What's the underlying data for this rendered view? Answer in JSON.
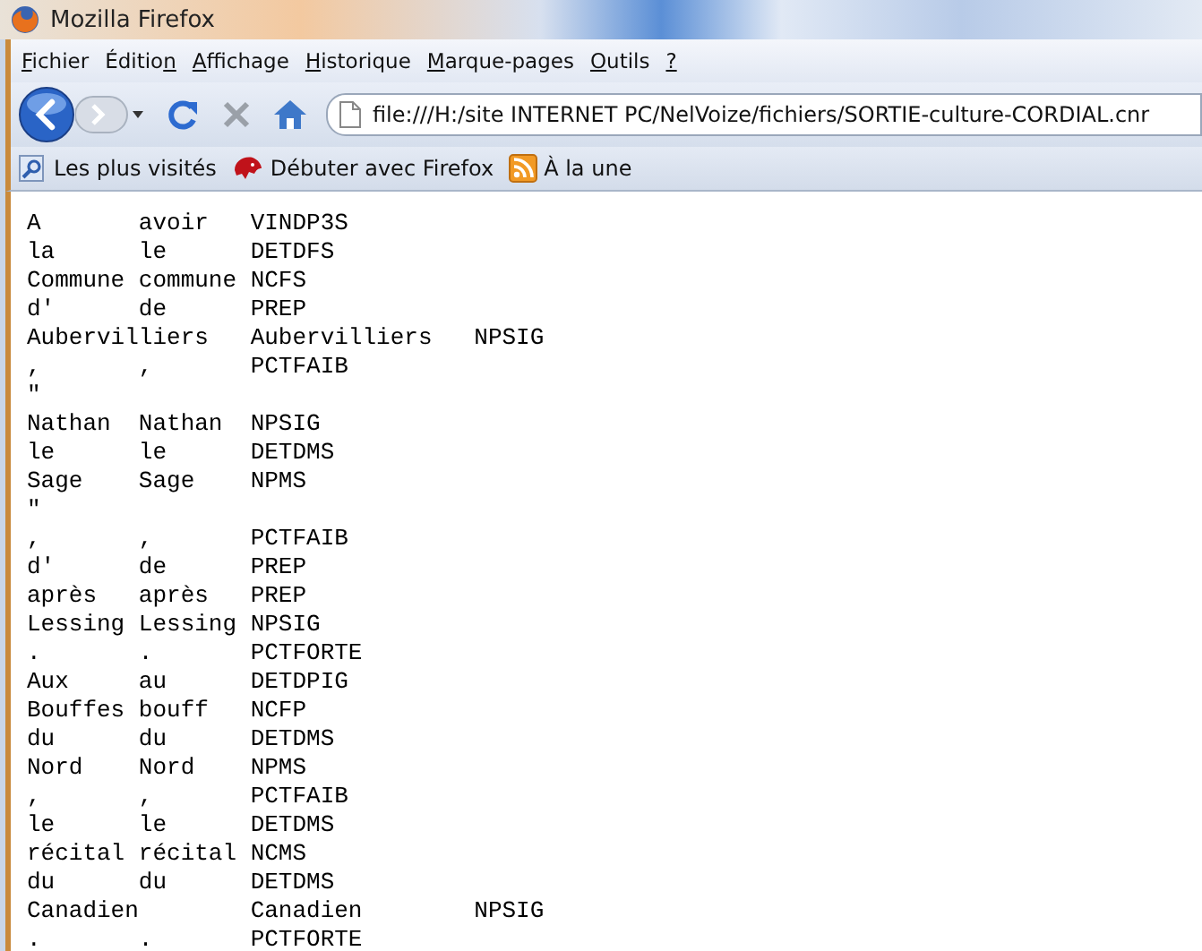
{
  "window": {
    "title": "Mozilla Firefox"
  },
  "menu": [
    {
      "key": "F",
      "after": "ichier"
    },
    {
      "before": "Éditio",
      "key": "n"
    },
    {
      "key": "A",
      "after": "ffichage"
    },
    {
      "key": "H",
      "after": "istorique"
    },
    {
      "key": "M",
      "after": "arque-pages"
    },
    {
      "key": "O",
      "after": "utils"
    },
    {
      "key": "?"
    }
  ],
  "address": {
    "value": "file:///H:/site INTERNET PC/NelVoize/fichiers/SORTIE-culture-CORDIAL.cnr"
  },
  "bookmarks": [
    {
      "label": "Les plus visités",
      "kind": "smart"
    },
    {
      "label": "Débuter avec Firefox",
      "kind": "firefox"
    },
    {
      "label": "À la une",
      "kind": "feed"
    }
  ],
  "content": {
    "lines": [
      "A\tavoir\tVINDP3S",
      "la\tle\tDETDFS",
      "Commune\tcommune\tNCFS",
      "d'\tde\tPREP",
      "Aubervilliers\tAubervilliers\tNPSIG",
      ",\t,\tPCTFAIB",
      "\"",
      "Nathan\tNathan\tNPSIG",
      "le\tle\tDETDMS",
      "Sage\tSage\tNPMS",
      "\"",
      ",\t,\tPCTFAIB",
      "d'\tde\tPREP",
      "après\taprès\tPREP",
      "Lessing\tLessing\tNPSIG",
      ".\t.\tPCTFORTE",
      "Aux\tau\tDETDPIG",
      "Bouffes\tbouff\tNCFP",
      "du\tdu\tDETDMS",
      "Nord\tNord\tNPMS",
      ",\t,\tPCTFAIB",
      "le\tle\tDETDMS",
      "récital\trécital\tNCMS",
      "du\tdu\tDETDMS",
      "Canadien\tCanadien\tNPSIG",
      ".\t.\tPCTFORTE"
    ]
  }
}
